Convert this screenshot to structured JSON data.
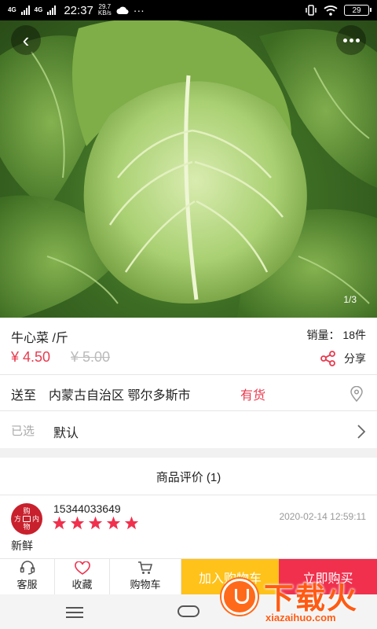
{
  "status_bar": {
    "net1": "4G",
    "net2": "4G",
    "time": "22:37",
    "speed_value": "29.7",
    "speed_unit": "KB/s",
    "dots": "···",
    "battery": "29"
  },
  "hero": {
    "pager": "1/3"
  },
  "product": {
    "name": "牛心菜 /斤",
    "sales": "销量： 18件",
    "price": "¥ 4.50",
    "old_price": "¥ 5.00",
    "share_label": "分享"
  },
  "shipping": {
    "label": "送至",
    "address": "内蒙古自治区 鄂尔多斯市",
    "stock": "有货"
  },
  "spec": {
    "label": "已选",
    "value": "默认"
  },
  "reviews": {
    "header": "商品评价 (1)",
    "items": [
      {
        "avatar_line1": "购",
        "avatar_line2": "方",
        "avatar_line2b": "内",
        "avatar_line3": "物",
        "user": "15344033649",
        "date": "2020-02-14 12:59:11",
        "rating": 5,
        "text": "新鲜"
      }
    ]
  },
  "bottom_bar": {
    "service": "客服",
    "favorite": "收藏",
    "cart": "购物车",
    "add_to_cart": "加入购物车",
    "buy_now": "立即购买"
  },
  "watermark": {
    "title": "下载火",
    "site": "xiazaihuo.com"
  },
  "colors": {
    "accent_red": "#e83a4e",
    "add_cart": "#ffc21a",
    "buy_now": "#f0304d"
  }
}
